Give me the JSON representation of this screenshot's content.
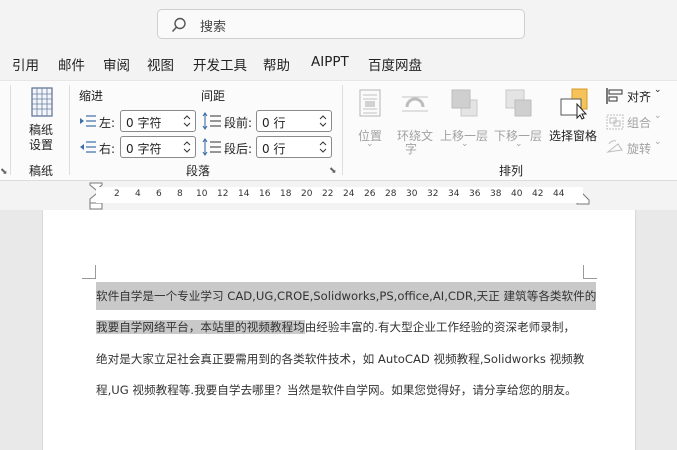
{
  "search": {
    "placeholder": "搜索"
  },
  "menu": [
    "引用",
    "邮件",
    "审阅",
    "视图",
    "开发工具",
    "帮助",
    "AIPPT",
    "百度网盘"
  ],
  "ribbon": {
    "manuscript": {
      "button": "稿纸\n设置",
      "line1": "稿纸",
      "line2": "设置",
      "group": "稿纸"
    },
    "paragraph": {
      "indent_header": "缩进",
      "spacing_header": "间距",
      "left_label": "左:",
      "left_value": "0 字符",
      "right_label": "右:",
      "right_value": "0 字符",
      "before_label": "段前:",
      "before_value": "0 行",
      "after_label": "段后:",
      "after_value": "0 行",
      "group": "段落"
    },
    "arrange": {
      "position": "位置",
      "wrap_line1": "环绕文",
      "wrap_line2": "字",
      "bring_forward": "上移一层",
      "send_backward": "下移一层",
      "selection_pane": "选择窗格",
      "align": "对齐",
      "group_btn": "组合",
      "rotate": "旋转",
      "group": "排列"
    }
  },
  "ruler": {
    "ticks": [
      "2",
      "4",
      "6",
      "8",
      "10",
      "12",
      "14",
      "16",
      "18",
      "20",
      "22",
      "24",
      "26",
      "28",
      "30",
      "32",
      "34",
      "36",
      "38",
      "40",
      "42",
      "44"
    ]
  },
  "document": {
    "line1_hl": "软件自学是一个专业学习 CAD,UG,CROE,Solidworks,PS,office,AI,CDR,天正 建筑等各类软件的",
    "line2_hl": "我要自学网络平台，本站里的视频教程均",
    "line2_rest": "由经验丰富的.有大型企业工作经验的资深老师录制，",
    "line3": "绝对是大家立足社会真正要需用到的各类软件技术，如 AutoCAD 视频教程,Solidworks 视频教",
    "line4": "程,UG 视频教程等.我要自学去哪里？当然是软件自学网。如果您觉得好，请分享给您的朋友。"
  }
}
